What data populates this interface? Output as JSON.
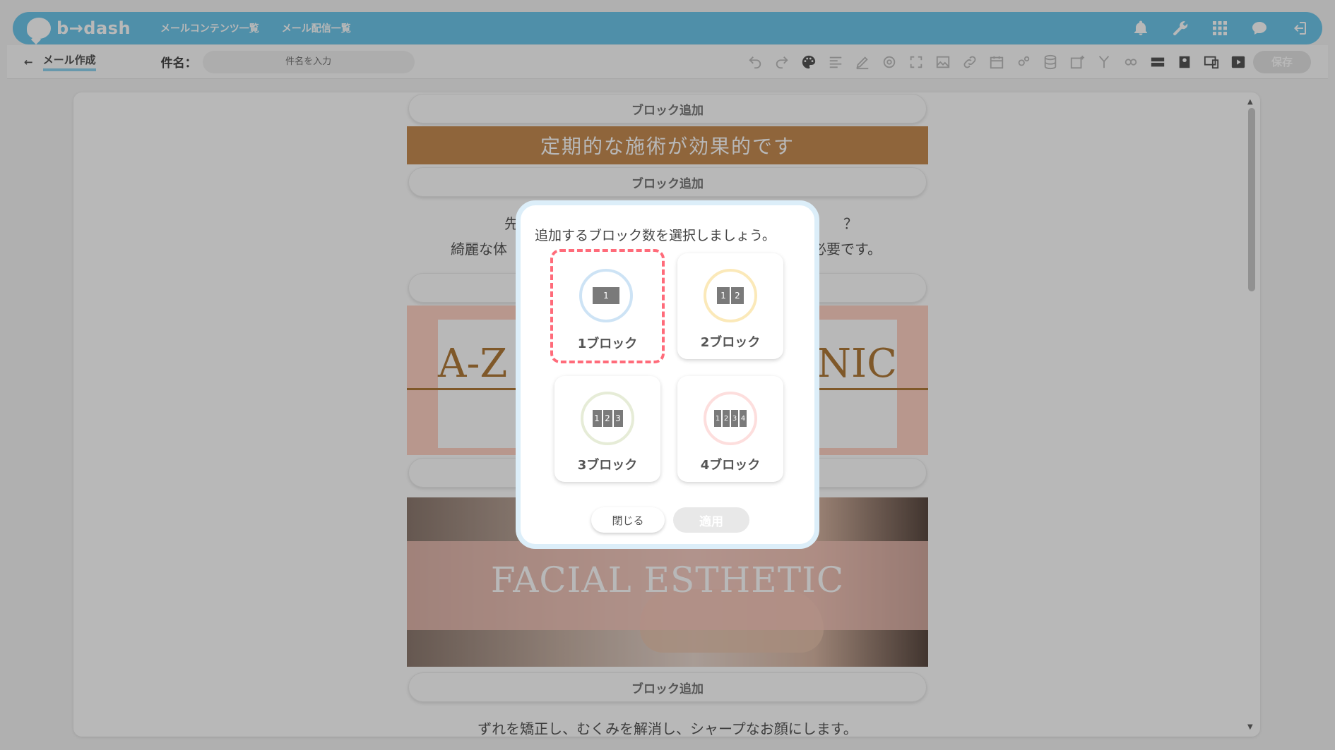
{
  "app": {
    "logo_text": "b→dash"
  },
  "topnav": {
    "item1": "メールコンテンツ一覧",
    "item2": "メール配信一覧"
  },
  "top_icons": [
    "bell-icon",
    "wrench-icon",
    "grid-icon",
    "help-chat-icon",
    "logout-icon"
  ],
  "subbar": {
    "back_label": "メール作成",
    "subject_label": "件名：",
    "subject_placeholder": "件名を入力",
    "subject_value": "",
    "save_label": "保存"
  },
  "editor": {
    "add_block_label": "ブロック追加",
    "headline": "定期的な施術が効果的です",
    "para1_line1_left": "先",
    "para1_line1_right": "？",
    "para1_line2_left": "綺麗な体",
    "para1_line2_right": "必要です。",
    "banner_text_left": "A-Z",
    "banner_text_right": "NIC",
    "photo_text": "FACIAL ESTHETIC",
    "para2": "ずれを矯正し、むくみを解消し、シャープなお顔にします。"
  },
  "modal": {
    "title": "追加するブロック数を選択しましょう。",
    "options": [
      {
        "label": "1ブロック",
        "cells": [
          "1"
        ],
        "selected": true
      },
      {
        "label": "2ブロック",
        "cells": [
          "1",
          "2"
        ],
        "selected": false
      },
      {
        "label": "3ブロック",
        "cells": [
          "1",
          "2",
          "3"
        ],
        "selected": false
      },
      {
        "label": "4ブロック",
        "cells": [
          "1",
          "2",
          "3",
          "4"
        ],
        "selected": false
      }
    ],
    "close_label": "閉じる",
    "apply_label": "適用"
  },
  "colors": {
    "topbar": "#6ec6ea",
    "headline_bg": "#c68c53",
    "selected_border": "#ff6b7a"
  }
}
